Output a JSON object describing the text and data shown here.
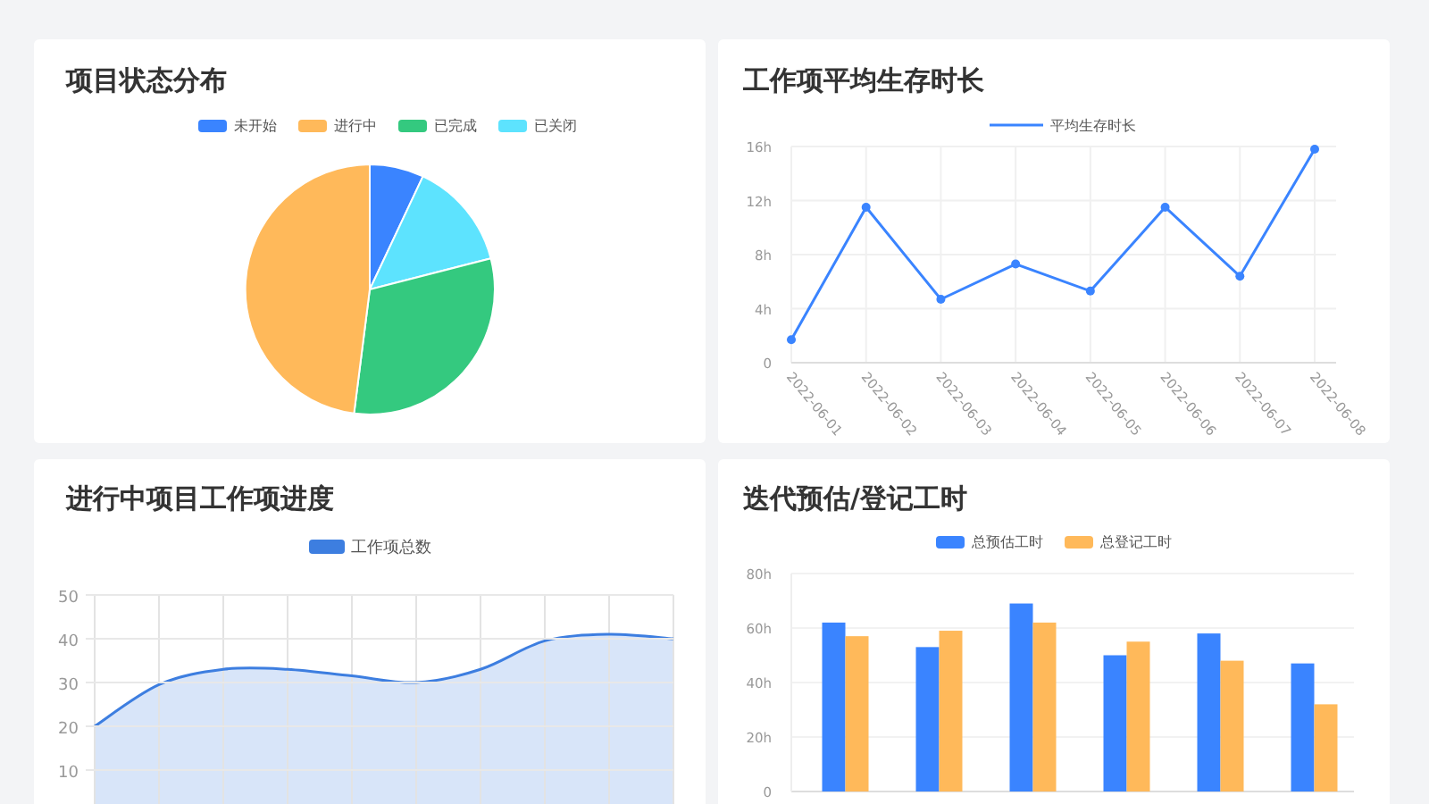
{
  "panels": [
    {
      "title": "项目状态分布",
      "chart_data": {
        "type": "pie",
        "categories": [
          "未开始",
          "进行中",
          "已完成",
          "已关闭"
        ],
        "values": [
          7,
          48,
          31,
          14
        ],
        "colors": [
          "#3a84ff",
          "#ffb95a",
          "#34c97f",
          "#5de3fe"
        ]
      }
    },
    {
      "title": "工作项平均生存时长",
      "chart_data": {
        "type": "line",
        "categories": [
          "2022-06-01",
          "2022-06-02",
          "2022-06-03",
          "2022-06-04",
          "2022-06-05",
          "2022-06-06",
          "2022-06-07",
          "2022-06-08"
        ],
        "ylim": [
          0,
          16
        ],
        "yticks": [
          {
            "value": 0,
            "label": "0"
          },
          {
            "value": 4,
            "label": "4h"
          },
          {
            "value": 8,
            "label": "8h"
          },
          {
            "value": 12,
            "label": "12h"
          },
          {
            "value": 16,
            "label": "16h"
          }
        ],
        "grid": true,
        "series": [
          {
            "name": "平均生存时长",
            "color": "#3a84ff",
            "marker": "circle",
            "values": [
              1.7,
              11.5,
              4.7,
              7.3,
              5.3,
              11.5,
              6.4,
              15.8
            ]
          }
        ]
      }
    },
    {
      "title": "进行中项目工作项进度",
      "chart_data": {
        "type": "area",
        "ylim": [
          0,
          50
        ],
        "yticks": [
          10,
          20,
          30,
          40,
          50
        ],
        "grid": true,
        "series": [
          {
            "name": "工作项总数",
            "color": "#3d7ee0",
            "values": [
              20,
              29.5,
              33,
              33,
              31.5,
              30,
              33,
              39.5,
              41,
              40
            ]
          }
        ]
      }
    },
    {
      "title": "迭代预估/登记工时",
      "chart_data": {
        "type": "bar",
        "ylim": [
          0,
          80
        ],
        "yticks": [
          {
            "value": 0,
            "label": "0"
          },
          {
            "value": 20,
            "label": "20h"
          },
          {
            "value": 40,
            "label": "40h"
          },
          {
            "value": 60,
            "label": "60h"
          },
          {
            "value": 80,
            "label": "80h"
          }
        ],
        "grid": true,
        "series": [
          {
            "name": "总预估工时",
            "color": "#3a84ff",
            "values": [
              62,
              53,
              69,
              50,
              58,
              47
            ]
          },
          {
            "name": "总登记工时",
            "color": "#ffb95a",
            "values": [
              57,
              59,
              62,
              55,
              48,
              32
            ]
          }
        ]
      }
    }
  ]
}
